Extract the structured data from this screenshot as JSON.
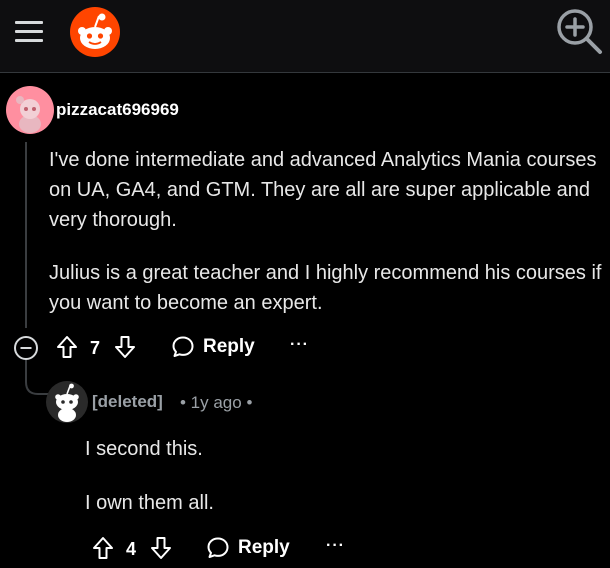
{
  "header": {
    "menu_icon": "hamburger-menu-icon",
    "logo_icon": "reddit-logo-icon",
    "search_icon": "search-zoom-icon",
    "brand_color": "#ff4500"
  },
  "comment": {
    "username": "pizzacat696969",
    "avatar_color": "#ff8fa0",
    "paragraphs": [
      "I've done intermediate and advanced Analytics Mania courses on UA, GA4, and GTM. They are all are super applicable and very thorough.",
      "Julius is a great teacher and I highly recommend his courses if you want to become an expert."
    ],
    "score": "7",
    "reply_label": "Reply",
    "more_label": "···"
  },
  "reply": {
    "username": "[deleted]",
    "meta": "• 1y ago •",
    "lines": [
      "I second this.",
      "I own them all."
    ],
    "score": "4",
    "reply_label": "Reply",
    "more_label": "···"
  }
}
